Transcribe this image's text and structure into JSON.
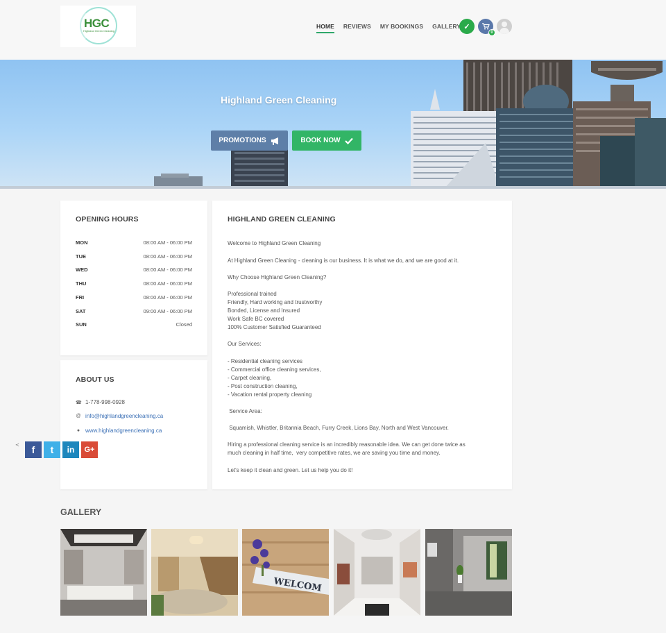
{
  "logo": {
    "mark": "HGC",
    "subtitle": "Highland Green Cleaning"
  },
  "nav": {
    "items": [
      "HOME",
      "REVIEWS",
      "MY BOOKINGS",
      "GALLERY"
    ]
  },
  "header_icons": [
    "check-icon",
    "cart-icon",
    "user-avatar-icon"
  ],
  "hero": {
    "title": "Highland Green Cleaning",
    "promotions_label": "PROMOTIONS",
    "book_now_label": "BOOK NOW"
  },
  "hours": {
    "title": "OPENING HOURS",
    "rows": [
      {
        "day": "MON",
        "time": "08:00 AM - 06:00 PM"
      },
      {
        "day": "TUE",
        "time": "08:00 AM - 06:00 PM"
      },
      {
        "day": "WED",
        "time": "08:00 AM - 06:00 PM"
      },
      {
        "day": "THU",
        "time": "08:00 AM - 06:00 PM"
      },
      {
        "day": "FRI",
        "time": "08:00 AM - 06:00 PM"
      },
      {
        "day": "SAT",
        "time": "09:00 AM - 06:00 PM"
      },
      {
        "day": "SUN",
        "time": "Closed"
      }
    ]
  },
  "about": {
    "title": "ABOUT US",
    "phone": "1-778-998-0928",
    "email": "info@highlandgreencleaning.ca",
    "website": "www.highlandgreencleaning.ca",
    "social": [
      "f",
      "t",
      "in",
      "G+"
    ]
  },
  "main": {
    "title": "HIGHLAND GREEN CLEANING",
    "welcome": "Welcome to Highland Green Cleaning",
    "intro": "At Highland Green Cleaning - cleaning is our business. It is what we do, and we are good at it.",
    "why": "Why Choose Highland Green Cleaning?",
    "reasons": "Professional trained\nFriendly, Hard working and trustworthy\nBonded, License and Insured\nWork Safe BC covered\n100% Customer Satisfied Guaranteed",
    "services_title": "Our Services:",
    "services": "- Residential cleaning services\n- Commercial office cleaning services,\n- Carpet cleaning,\n- Post construction cleaning,\n- Vacation rental property cleaning",
    "area_title": " Service Area:",
    "area": " Squamish, Whistler, Britannia Beach, Furry Creek, Lions Bay, North and West Vancouver.",
    "hiring": "Hiring a professional cleaning service is an incredibly reasonable idea. We can get done twice as\nmuch cleaning in half time,  very competitive rates, we are saving you time and money.",
    "closing": "Let's keep it clean and green. Let us help you do it!"
  },
  "gallery": {
    "title": "GALLERY"
  }
}
